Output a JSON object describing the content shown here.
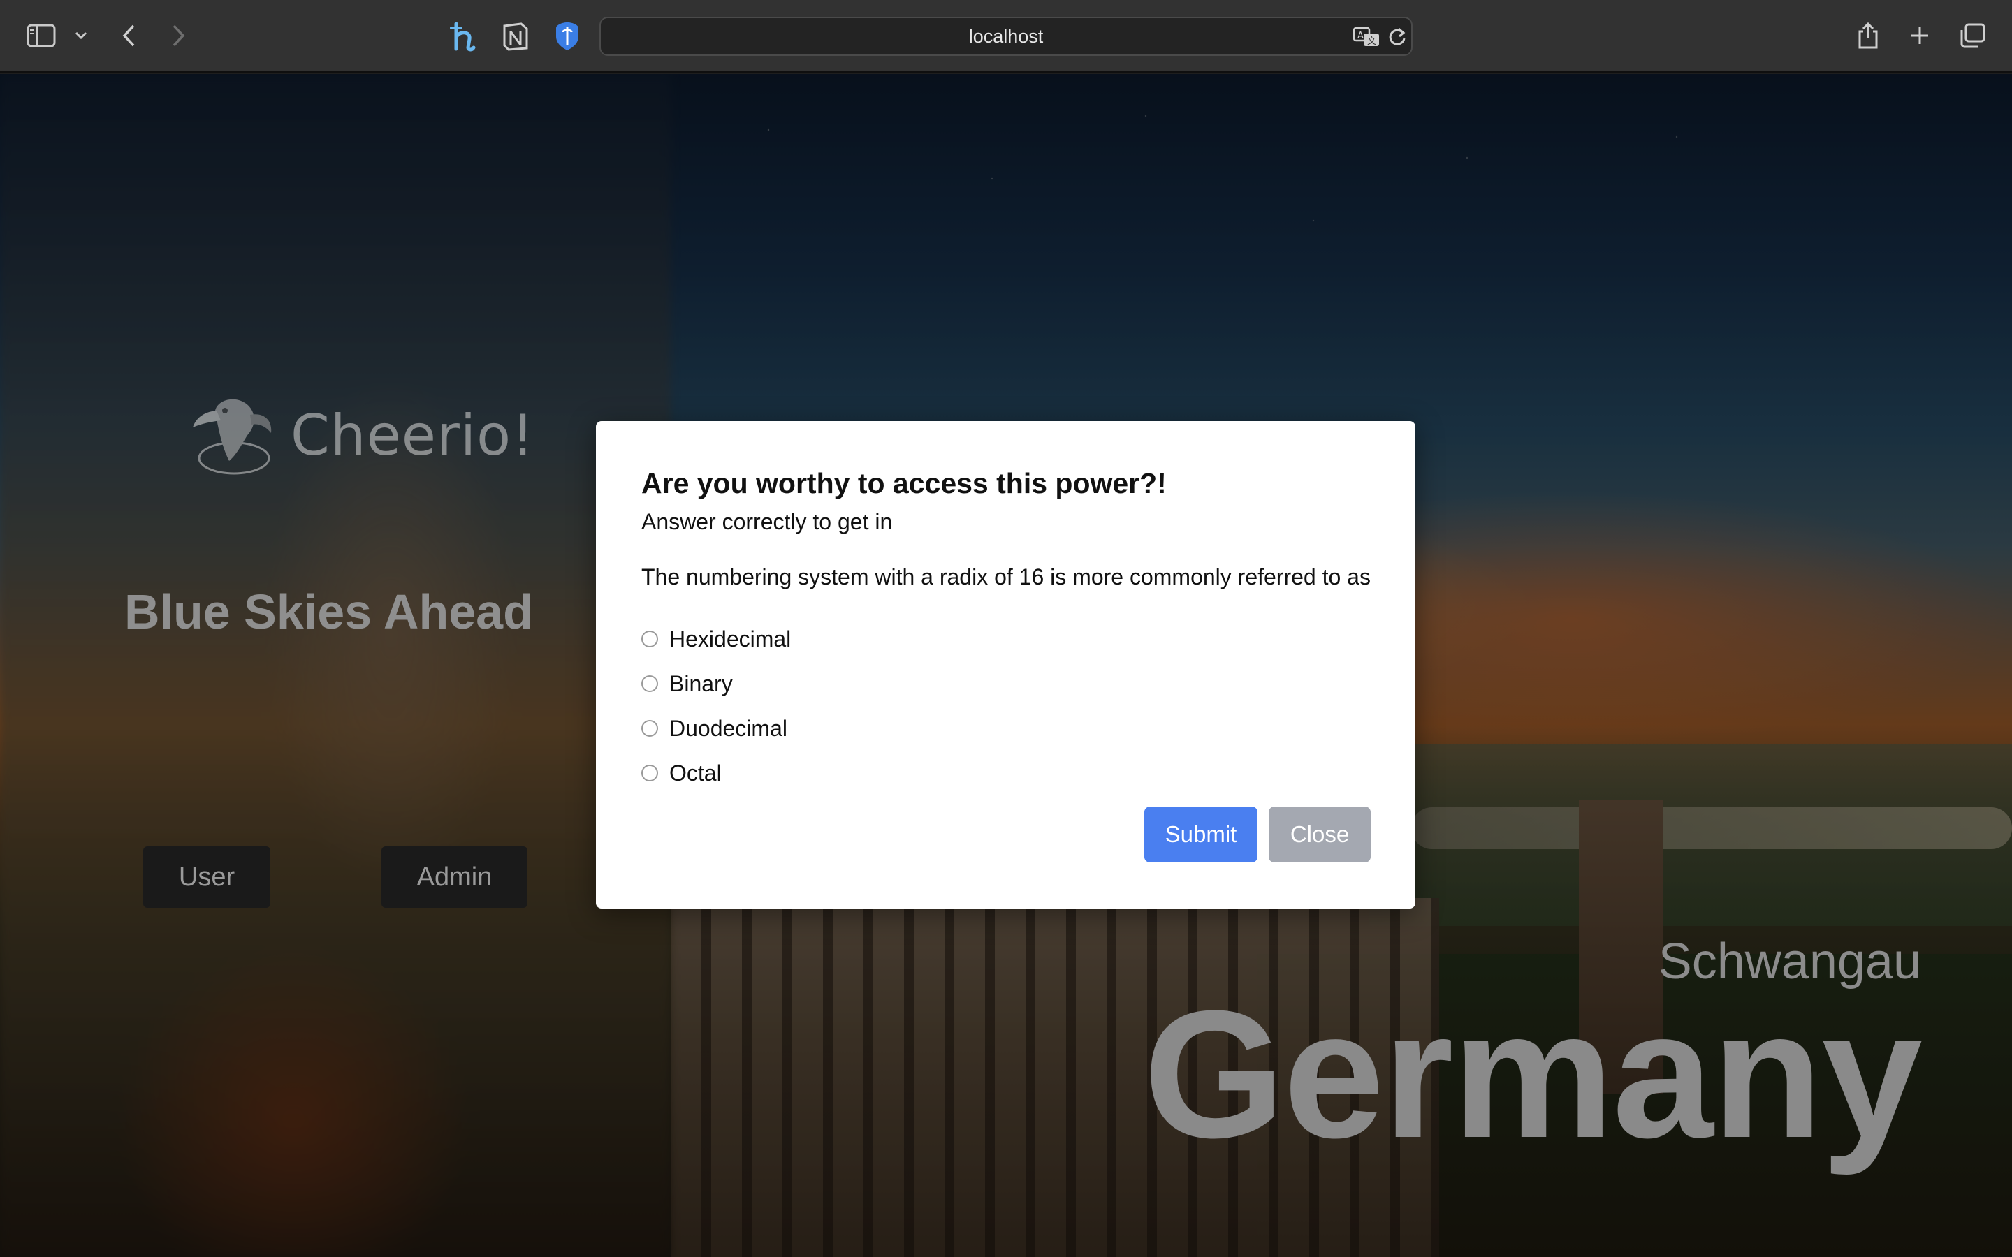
{
  "browser": {
    "url": "localhost",
    "icons": {
      "sidebar": "sidebar-icon",
      "back": "chevron-left-icon",
      "forward": "chevron-right-icon",
      "ext1": "hypothesis-h-icon",
      "ext2": "notion-icon",
      "ext3": "bitwarden-shield-icon",
      "translate": "translate-icon",
      "reload": "reload-icon",
      "share": "share-icon",
      "new_tab": "plus-icon",
      "tabs": "tabs-overview-icon"
    }
  },
  "page": {
    "logo_text": "Cheerio!",
    "hero_title": "Blue Skies Ahead",
    "buttons": {
      "user": "User",
      "admin": "Admin"
    },
    "place_small": "Schwangau",
    "place_big": "Germany"
  },
  "modal": {
    "title": "Are you worthy to access this power?!",
    "subtitle": "Answer correctly to get in",
    "question": "The numbering system with a radix of 16 is more commonly referred to as",
    "options": [
      "Hexidecimal",
      "Binary",
      "Duodecimal",
      "Octal"
    ],
    "submit_label": "Submit",
    "close_label": "Close"
  },
  "colors": {
    "submit": "#4a7ff0",
    "close": "#a4a8b1",
    "chrome": "#323232"
  }
}
